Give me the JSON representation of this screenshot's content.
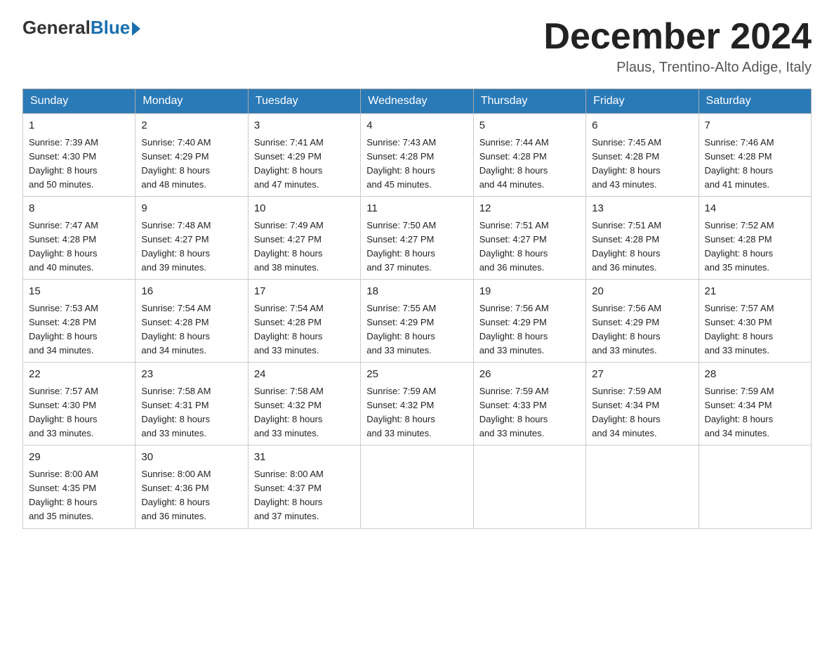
{
  "header": {
    "logo_general": "General",
    "logo_blue": "Blue",
    "month_title": "December 2024",
    "location": "Plaus, Trentino-Alto Adige, Italy"
  },
  "days_of_week": [
    "Sunday",
    "Monday",
    "Tuesday",
    "Wednesday",
    "Thursday",
    "Friday",
    "Saturday"
  ],
  "weeks": [
    [
      {
        "day": "1",
        "sunrise": "7:39 AM",
        "sunset": "4:30 PM",
        "daylight": "8 hours and 50 minutes."
      },
      {
        "day": "2",
        "sunrise": "7:40 AM",
        "sunset": "4:29 PM",
        "daylight": "8 hours and 48 minutes."
      },
      {
        "day": "3",
        "sunrise": "7:41 AM",
        "sunset": "4:29 PM",
        "daylight": "8 hours and 47 minutes."
      },
      {
        "day": "4",
        "sunrise": "7:43 AM",
        "sunset": "4:28 PM",
        "daylight": "8 hours and 45 minutes."
      },
      {
        "day": "5",
        "sunrise": "7:44 AM",
        "sunset": "4:28 PM",
        "daylight": "8 hours and 44 minutes."
      },
      {
        "day": "6",
        "sunrise": "7:45 AM",
        "sunset": "4:28 PM",
        "daylight": "8 hours and 43 minutes."
      },
      {
        "day": "7",
        "sunrise": "7:46 AM",
        "sunset": "4:28 PM",
        "daylight": "8 hours and 41 minutes."
      }
    ],
    [
      {
        "day": "8",
        "sunrise": "7:47 AM",
        "sunset": "4:28 PM",
        "daylight": "8 hours and 40 minutes."
      },
      {
        "day": "9",
        "sunrise": "7:48 AM",
        "sunset": "4:27 PM",
        "daylight": "8 hours and 39 minutes."
      },
      {
        "day": "10",
        "sunrise": "7:49 AM",
        "sunset": "4:27 PM",
        "daylight": "8 hours and 38 minutes."
      },
      {
        "day": "11",
        "sunrise": "7:50 AM",
        "sunset": "4:27 PM",
        "daylight": "8 hours and 37 minutes."
      },
      {
        "day": "12",
        "sunrise": "7:51 AM",
        "sunset": "4:27 PM",
        "daylight": "8 hours and 36 minutes."
      },
      {
        "day": "13",
        "sunrise": "7:51 AM",
        "sunset": "4:28 PM",
        "daylight": "8 hours and 36 minutes."
      },
      {
        "day": "14",
        "sunrise": "7:52 AM",
        "sunset": "4:28 PM",
        "daylight": "8 hours and 35 minutes."
      }
    ],
    [
      {
        "day": "15",
        "sunrise": "7:53 AM",
        "sunset": "4:28 PM",
        "daylight": "8 hours and 34 minutes."
      },
      {
        "day": "16",
        "sunrise": "7:54 AM",
        "sunset": "4:28 PM",
        "daylight": "8 hours and 34 minutes."
      },
      {
        "day": "17",
        "sunrise": "7:54 AM",
        "sunset": "4:28 PM",
        "daylight": "8 hours and 33 minutes."
      },
      {
        "day": "18",
        "sunrise": "7:55 AM",
        "sunset": "4:29 PM",
        "daylight": "8 hours and 33 minutes."
      },
      {
        "day": "19",
        "sunrise": "7:56 AM",
        "sunset": "4:29 PM",
        "daylight": "8 hours and 33 minutes."
      },
      {
        "day": "20",
        "sunrise": "7:56 AM",
        "sunset": "4:29 PM",
        "daylight": "8 hours and 33 minutes."
      },
      {
        "day": "21",
        "sunrise": "7:57 AM",
        "sunset": "4:30 PM",
        "daylight": "8 hours and 33 minutes."
      }
    ],
    [
      {
        "day": "22",
        "sunrise": "7:57 AM",
        "sunset": "4:30 PM",
        "daylight": "8 hours and 33 minutes."
      },
      {
        "day": "23",
        "sunrise": "7:58 AM",
        "sunset": "4:31 PM",
        "daylight": "8 hours and 33 minutes."
      },
      {
        "day": "24",
        "sunrise": "7:58 AM",
        "sunset": "4:32 PM",
        "daylight": "8 hours and 33 minutes."
      },
      {
        "day": "25",
        "sunrise": "7:59 AM",
        "sunset": "4:32 PM",
        "daylight": "8 hours and 33 minutes."
      },
      {
        "day": "26",
        "sunrise": "7:59 AM",
        "sunset": "4:33 PM",
        "daylight": "8 hours and 33 minutes."
      },
      {
        "day": "27",
        "sunrise": "7:59 AM",
        "sunset": "4:34 PM",
        "daylight": "8 hours and 34 minutes."
      },
      {
        "day": "28",
        "sunrise": "7:59 AM",
        "sunset": "4:34 PM",
        "daylight": "8 hours and 34 minutes."
      }
    ],
    [
      {
        "day": "29",
        "sunrise": "8:00 AM",
        "sunset": "4:35 PM",
        "daylight": "8 hours and 35 minutes."
      },
      {
        "day": "30",
        "sunrise": "8:00 AM",
        "sunset": "4:36 PM",
        "daylight": "8 hours and 36 minutes."
      },
      {
        "day": "31",
        "sunrise": "8:00 AM",
        "sunset": "4:37 PM",
        "daylight": "8 hours and 37 minutes."
      },
      null,
      null,
      null,
      null
    ]
  ],
  "labels": {
    "sunrise": "Sunrise:",
    "sunset": "Sunset:",
    "daylight": "Daylight:"
  }
}
